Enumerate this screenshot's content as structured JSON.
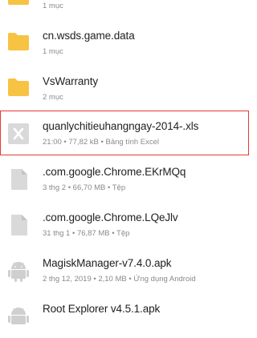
{
  "files": [
    {
      "name": "",
      "detail": "1 mục",
      "type": "folder"
    },
    {
      "name": "cn.wsds.game.data",
      "detail": "1 mục",
      "type": "folder"
    },
    {
      "name": "VsWarranty",
      "detail": "2 mục",
      "type": "folder"
    },
    {
      "name": "quanlychitieuhangngay-2014-.xls",
      "detail": "21:00 • 77,82 kB • Bảng tính Excel",
      "type": "excel",
      "selected": true
    },
    {
      "name": ".com.google.Chrome.EKrMQq",
      "detail": "3 thg 2 • 66,70 MB • Tệp",
      "type": "file"
    },
    {
      "name": ".com.google.Chrome.LQeJlv",
      "detail": "31 thg 1 • 76,87 MB • Tệp",
      "type": "file"
    },
    {
      "name": "MagiskManager-v7.4.0.apk",
      "detail": "2 thg 12, 2019 • 2,10 MB • Ứng dụng Android",
      "type": "apk"
    },
    {
      "name": "Root Explorer v4.5.1.apk",
      "detail": "",
      "type": "apk"
    }
  ],
  "colors": {
    "folder": "#f6c343",
    "highlight_border": "#e53935",
    "placeholder_icon": "#d9d9d9",
    "title_text": "#212121",
    "detail_text": "#8a8a8a"
  }
}
